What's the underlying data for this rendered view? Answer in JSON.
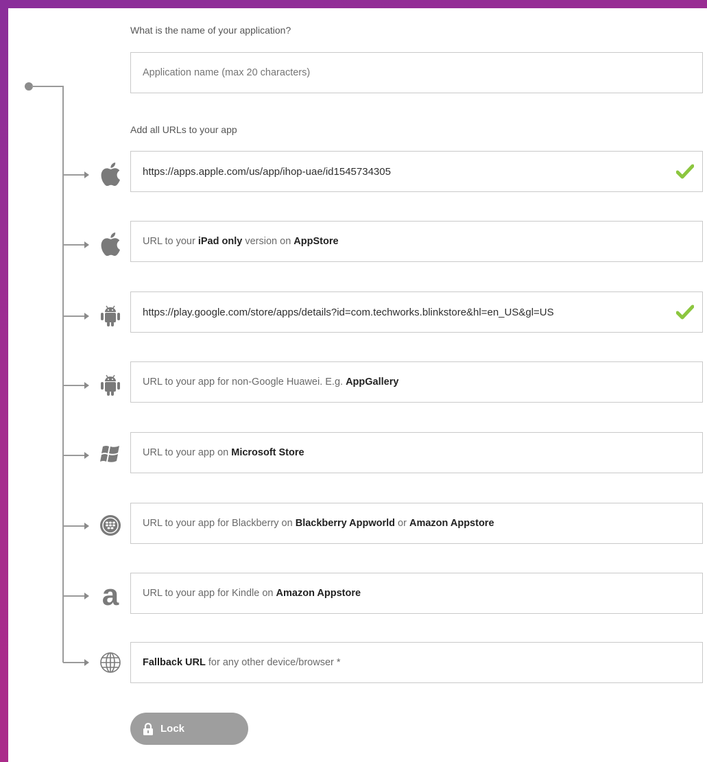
{
  "app_name": {
    "label": "What is the name of your application?",
    "placeholder": "Application name (max 20 characters)"
  },
  "urls_label": "Add all URLs to your app",
  "fields": {
    "ios": {
      "value": "https://apps.apple.com/us/app/ihop-uae/id1545734305",
      "valid": true,
      "icon": "apple-icon"
    },
    "ipad": {
      "p1": "URL to your ",
      "b1": "iPad only",
      "p2": " version on ",
      "b2": "AppStore",
      "icon": "apple-icon"
    },
    "android": {
      "value": "https://play.google.com/store/apps/details?id=com.techworks.blinkstore&hl=en_US&gl=US",
      "valid": true,
      "icon": "android-icon"
    },
    "huawei": {
      "p1": "URL to your app for non-Google Huawei. E.g. ",
      "b1": "AppGallery",
      "icon": "android-icon"
    },
    "microsoft": {
      "p1": "URL to your app on ",
      "b1": "Microsoft Store",
      "icon": "windows-icon"
    },
    "blackberry": {
      "p1": "URL to your app for Blackberry on ",
      "b1": "Blackberry Appworld",
      "p2": " or ",
      "b2": "Amazon Appstore",
      "icon": "blackberry-icon"
    },
    "kindle": {
      "p1": "URL to your app for Kindle on ",
      "b1": "Amazon Appstore",
      "icon": "amazon-icon"
    },
    "fallback": {
      "b1": "Fallback URL",
      "p1": " for any other device/browser *",
      "icon": "globe-icon"
    }
  },
  "lock_button": {
    "label": "Lock",
    "icon": "lock-icon"
  },
  "colors": {
    "check": "#8cc63f",
    "button": "#9e9e9e",
    "icon": "#7a7a7a"
  }
}
